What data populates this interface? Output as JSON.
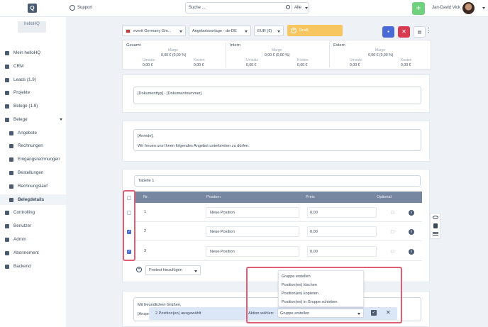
{
  "topbar": {
    "logo_text": "Q",
    "support_label": "Support",
    "search_placeholder": "Suche ...",
    "search_scope": "Alle",
    "user_name": "Jan-David Vick"
  },
  "sidebar": {
    "brand": "helloHQ",
    "items": [
      {
        "label": "Mein helloHQ"
      },
      {
        "label": "CRM"
      },
      {
        "label": "Leads (1.9)"
      },
      {
        "label": "Projekte"
      },
      {
        "label": "Belege (1.9)"
      },
      {
        "label": "Belege"
      },
      {
        "label": "Angebote"
      },
      {
        "label": "Rechnungen"
      },
      {
        "label": "Eingangsrechnungen"
      },
      {
        "label": "Bestellungen"
      },
      {
        "label": "Rechnungslauf"
      },
      {
        "label": "Belegdetails"
      },
      {
        "label": "Controlling"
      },
      {
        "label": "Benutzer"
      },
      {
        "label": "Admin"
      },
      {
        "label": "Abonnement"
      },
      {
        "label": "Backend"
      }
    ]
  },
  "toolbar": {
    "company": "everit Germany Gm...",
    "template": "Angebotsvorlage - de-DE",
    "currency": "EUR (€)",
    "status": "Draft"
  },
  "summary": {
    "columns": [
      {
        "title": "Gesamt",
        "marge_label": "Marge",
        "marge_value": "0,00 € (0,00 %)",
        "umsatz_label": "Umsatz",
        "umsatz_value": "0,00 €",
        "kosten_label": "Kosten",
        "kosten_value": "0,00 €"
      },
      {
        "title": "Intern",
        "marge_label": "Marge",
        "marge_value": "0,00 € (0,00 %)",
        "umsatz_label": "Umsatz",
        "umsatz_value": "0,00 €",
        "kosten_label": "Kosten",
        "kosten_value": "0,00 €"
      },
      {
        "title": "Extern",
        "marge_label": "Marge",
        "marge_value": "0,00 € (0,00 %)",
        "umsatz_label": "Umsatz",
        "umsatz_value": "0,00 €",
        "kosten_label": "Kosten",
        "kosten_value": "0,00 €"
      }
    ]
  },
  "document": {
    "title_field": "[Dokumenttyp] - [Dokumentnummer]",
    "intro_line1": "[Anrede],",
    "intro_line2": "Wir freuen uns Ihnen folgendes Angebot unterbreiten zu dürfen.",
    "table_name": "Tabelle 1",
    "headers": {
      "nr": "Nr.",
      "position": "Position",
      "price": "Preis",
      "optional": "Optional"
    },
    "rows": [
      {
        "nr": "1",
        "position": "Neue Position",
        "price": "0,00",
        "checked": false
      },
      {
        "nr": "2",
        "position": "Neue Position",
        "price": "0,00",
        "checked": true
      },
      {
        "nr": "3",
        "position": "Neue Position",
        "price": "0,00",
        "checked": true
      }
    ],
    "add_label": "Freitext hinzufügen",
    "closing_line1": "Mit freundlichen Grüßen,",
    "closing_line2": "[Anspr"
  },
  "bulk": {
    "selected_text": "2 Position(en) ausgewählt",
    "action_label": "Aktion wählen:",
    "action_value": "Gruppe erstellen",
    "menu_items": [
      "Gruppe erstellen",
      "Position(en) löschen",
      "Position(en) kopieren",
      "Position(en) in Gruppe schieben"
    ]
  },
  "colors": {
    "accent": "#4a69d4",
    "highlight": "#e05d73",
    "draft": "#f7c660",
    "add": "#6fd17d"
  }
}
